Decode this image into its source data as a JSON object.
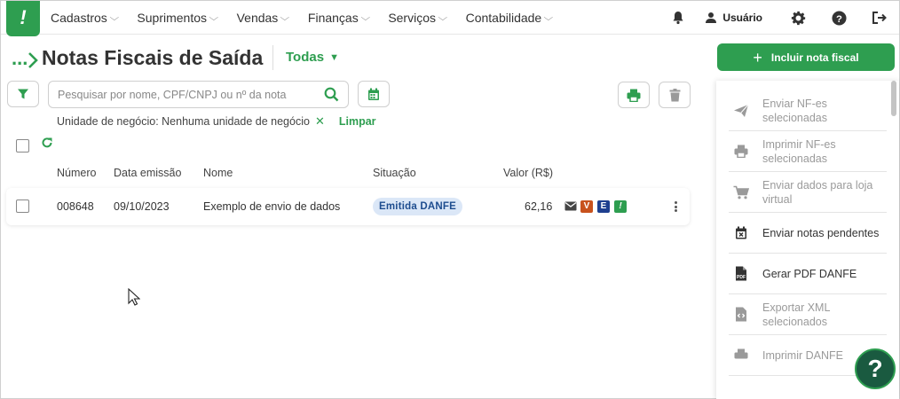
{
  "brand": {
    "logo_glyph": "!",
    "color": "#2e9e50"
  },
  "nav": {
    "items": [
      {
        "label": "Cadastros"
      },
      {
        "label": "Suprimentos"
      },
      {
        "label": "Vendas"
      },
      {
        "label": "Finanças"
      },
      {
        "label": "Serviços"
      },
      {
        "label": "Contabilidade"
      }
    ],
    "user_label": "Usuário",
    "icons": [
      "bell-icon",
      "user-icon",
      "gear-icon",
      "help-circle-icon",
      "logout-icon"
    ]
  },
  "header": {
    "breadcrumb": "...",
    "title": "Notas Fiscais de Saída",
    "filter_dropdown": "Todas"
  },
  "toolbar": {
    "search_placeholder": "Pesquisar por nome, CPF/CNPJ ou nº da nota",
    "active_filter": "Unidade de negócio: Nenhuma unidade de negócio",
    "clear_label": "Limpar"
  },
  "table": {
    "headers": [
      "Número",
      "Data emissão",
      "Nome",
      "Situação",
      "Valor (R$)"
    ],
    "rows": [
      {
        "numero": "008648",
        "data": "09/10/2023",
        "nome": "Exemplo de envio de dados",
        "situacao": "Emitida DANFE",
        "valor": "62,16",
        "markers": [
          "V",
          "E",
          "!"
        ]
      }
    ]
  },
  "side": {
    "primary_button": "Incluir nota fiscal",
    "actions": [
      {
        "label": "Enviar NF-es selecionadas",
        "icon": "send-icon",
        "enabled": false
      },
      {
        "label": "Imprimir NF-es selecionadas",
        "icon": "printer-icon",
        "enabled": false
      },
      {
        "label": "Enviar dados para loja virtual",
        "icon": "cart-icon",
        "enabled": false
      },
      {
        "label": "Enviar notas pendentes",
        "icon": "calendar-x-icon",
        "enabled": true
      },
      {
        "label": "Gerar PDF DANFE",
        "icon": "pdf-file-icon",
        "enabled": true
      },
      {
        "label": "Exportar XML selecionados",
        "icon": "code-file-icon",
        "enabled": false
      },
      {
        "label": "Imprimir DANFE",
        "icon": "printer-icon",
        "enabled": false
      }
    ]
  },
  "help_button": "?"
}
